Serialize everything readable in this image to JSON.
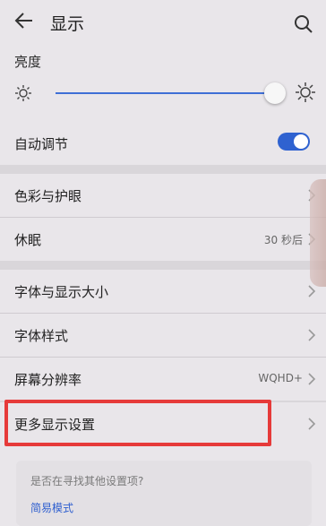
{
  "header": {
    "title": "显示"
  },
  "brightness": {
    "label": "亮度",
    "level": 0.97
  },
  "auto_adjust": {
    "label": "自动调节",
    "enabled": true
  },
  "rows": {
    "color": {
      "label": "色彩与护眼"
    },
    "sleep": {
      "label": "休眠",
      "value": "30 秒后"
    },
    "font_size": {
      "label": "字体与显示大小"
    },
    "font_style": {
      "label": "字体样式"
    },
    "resolution": {
      "label": "屏幕分辨率",
      "value": "WQHD+"
    },
    "more": {
      "label": "更多显示设置"
    }
  },
  "suggestion": {
    "title": "是否在寻找其他设置项?",
    "link": "简易模式"
  },
  "colors": {
    "accent": "#2f62d0",
    "highlight": "#e63a3a"
  },
  "icons": [
    "back-icon",
    "search-icon",
    "sun-small-icon",
    "sun-large-icon",
    "chevron-right-icon"
  ]
}
